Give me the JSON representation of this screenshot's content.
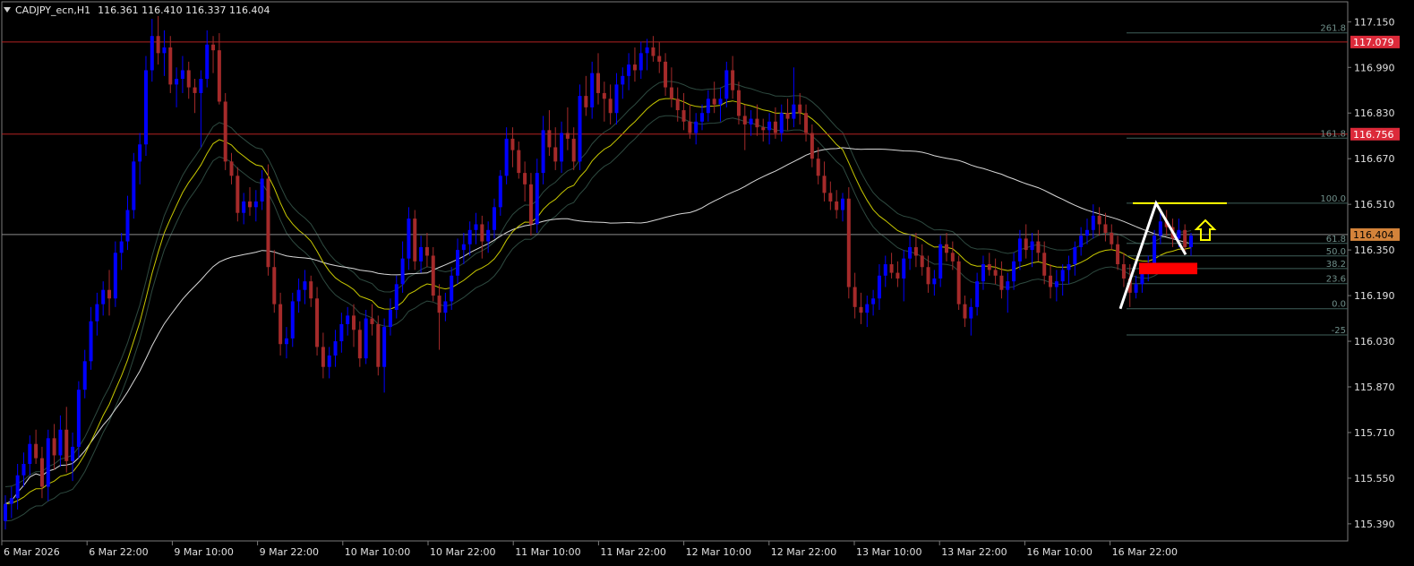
{
  "header": {
    "symbol": "CADJPY_ecn,H1",
    "ohlc": "116.361 116.410 116.337 116.404"
  },
  "colors": {
    "background": "#000000",
    "grid_frame": "#7a7a7a",
    "bull_candle": "#0000ff",
    "bear_candle": "#a52a2a",
    "ma_fast": "#c8c800",
    "ma_slow": "#d8d8d8",
    "envelope": "#2e4a40",
    "level_line": "#b22222",
    "fib_line": "#3f5f5a",
    "fib_label": "#6f8f8a",
    "price_tag": "#dc2a3a",
    "current_price_tag": "#d3833a",
    "accent_yellow": "#ffff00",
    "zone_red": "#ff0000"
  },
  "chart_data": {
    "type": "candlestick",
    "symbol": "CADJPY_ecn",
    "timeframe": "H1",
    "ylim": [
      115.33,
      117.22
    ],
    "y_ticks": [
      "117.150",
      "116.990",
      "116.830",
      "116.670",
      "116.510",
      "116.350",
      "116.190",
      "116.030",
      "115.870",
      "115.710",
      "115.550",
      "115.390"
    ],
    "x_ticks": [
      "6 Mar 2026",
      "6 Mar 22:00",
      "9 Mar 10:00",
      "9 Mar 22:00",
      "10 Mar 10:00",
      "10 Mar 22:00",
      "11 Mar 10:00",
      "11 Mar 22:00",
      "12 Mar 10:00",
      "12 Mar 22:00",
      "13 Mar 10:00",
      "13 Mar 22:00",
      "16 Mar 10:00",
      "16 Mar 22:00"
    ],
    "price_tags": [
      {
        "label": "117.079",
        "kind": "level"
      },
      {
        "label": "116.756",
        "kind": "level"
      },
      {
        "label": "116.404",
        "kind": "current"
      }
    ],
    "horizontal_levels": [
      117.079,
      116.756
    ],
    "current_price": 116.404,
    "fibonacci": [
      {
        "label": "261.8",
        "price": 117.111
      },
      {
        "label": "161.8",
        "price": 116.742
      },
      {
        "label": "100.0",
        "price": 116.514
      },
      {
        "label": "61.8",
        "price": 116.373
      },
      {
        "label": "50.0",
        "price": 116.329
      },
      {
        "label": "38.2",
        "price": 116.285
      },
      {
        "label": "23.6",
        "price": 116.232
      },
      {
        "label": "0.0",
        "price": 116.144
      },
      {
        "label": "-25",
        "price": 116.052
      }
    ],
    "ohlc": [
      [
        115.4,
        115.49,
        115.37,
        115.46
      ],
      [
        115.46,
        115.52,
        115.41,
        115.48
      ],
      [
        115.48,
        115.6,
        115.44,
        115.56
      ],
      [
        115.56,
        115.64,
        115.52,
        115.6
      ],
      [
        115.6,
        115.7,
        115.56,
        115.67
      ],
      [
        115.67,
        115.72,
        115.6,
        115.62
      ],
      [
        115.62,
        115.66,
        115.48,
        115.52
      ],
      [
        115.52,
        115.72,
        115.47,
        115.69
      ],
      [
        115.69,
        115.74,
        115.58,
        115.63
      ],
      [
        115.63,
        115.77,
        115.59,
        115.72
      ],
      [
        115.72,
        115.8,
        115.57,
        115.61
      ],
      [
        115.61,
        115.71,
        115.54,
        115.66
      ],
      [
        115.66,
        115.89,
        115.62,
        115.86
      ],
      [
        115.86,
        116.0,
        115.83,
        115.96
      ],
      [
        115.96,
        116.15,
        115.93,
        116.1
      ],
      [
        116.1,
        116.2,
        116.05,
        116.16
      ],
      [
        116.16,
        116.24,
        116.12,
        116.21
      ],
      [
        116.21,
        116.28,
        116.12,
        116.18
      ],
      [
        116.18,
        116.38,
        116.15,
        116.34
      ],
      [
        116.34,
        116.41,
        116.28,
        116.38
      ],
      [
        116.38,
        116.54,
        116.35,
        116.49
      ],
      [
        116.49,
        116.69,
        116.46,
        116.66
      ],
      [
        116.66,
        116.76,
        116.58,
        116.72
      ],
      [
        116.72,
        117.03,
        116.68,
        116.98
      ],
      [
        116.98,
        117.16,
        116.94,
        117.1
      ],
      [
        117.1,
        117.17,
        117.0,
        117.04
      ],
      [
        117.04,
        117.12,
        116.96,
        117.06
      ],
      [
        117.06,
        117.1,
        116.9,
        116.93
      ],
      [
        116.93,
        116.99,
        116.85,
        116.95
      ],
      [
        116.95,
        117.03,
        116.9,
        116.98
      ],
      [
        116.98,
        117.01,
        116.88,
        116.92
      ],
      [
        116.92,
        116.95,
        116.83,
        116.9
      ],
      [
        116.9,
        116.98,
        116.71,
        116.95
      ],
      [
        116.95,
        117.12,
        116.92,
        117.07
      ],
      [
        117.07,
        117.1,
        116.97,
        117.05
      ],
      [
        117.05,
        117.11,
        116.86,
        116.87
      ],
      [
        116.87,
        116.9,
        116.63,
        116.66
      ],
      [
        116.66,
        116.69,
        116.58,
        116.61
      ],
      [
        116.61,
        116.64,
        116.45,
        116.48
      ],
      [
        116.48,
        116.55,
        116.44,
        116.52
      ],
      [
        116.52,
        116.57,
        116.47,
        116.5
      ],
      [
        116.5,
        116.56,
        116.45,
        116.52
      ],
      [
        116.52,
        116.63,
        116.49,
        116.6
      ],
      [
        116.6,
        116.65,
        116.26,
        116.29
      ],
      [
        116.29,
        116.35,
        116.13,
        116.16
      ],
      [
        116.16,
        116.2,
        115.98,
        116.02
      ],
      [
        116.02,
        116.08,
        115.97,
        116.04
      ],
      [
        116.04,
        116.2,
        116.01,
        116.17
      ],
      [
        116.17,
        116.25,
        116.13,
        116.21
      ],
      [
        116.21,
        116.28,
        116.16,
        116.24
      ],
      [
        116.24,
        116.26,
        116.15,
        116.18
      ],
      [
        116.18,
        116.22,
        115.98,
        116.01
      ],
      [
        116.01,
        116.06,
        115.9,
        115.94
      ],
      [
        115.94,
        116.01,
        115.9,
        115.98
      ],
      [
        115.98,
        116.07,
        115.94,
        116.03
      ],
      [
        116.03,
        116.13,
        115.99,
        116.09
      ],
      [
        116.09,
        116.15,
        116.05,
        116.12
      ],
      [
        116.12,
        116.16,
        116.01,
        116.07
      ],
      [
        116.07,
        116.1,
        115.94,
        115.97
      ],
      [
        115.97,
        116.14,
        115.95,
        116.11
      ],
      [
        116.11,
        116.16,
        116.05,
        116.09
      ],
      [
        116.09,
        116.12,
        115.91,
        115.94
      ],
      [
        115.94,
        116.11,
        115.85,
        116.08
      ],
      [
        116.08,
        116.18,
        116.05,
        116.14
      ],
      [
        116.14,
        116.26,
        116.11,
        116.23
      ],
      [
        116.23,
        116.38,
        116.2,
        116.32
      ],
      [
        116.32,
        116.5,
        116.28,
        116.46
      ],
      [
        116.46,
        116.49,
        116.28,
        116.31
      ],
      [
        116.31,
        116.4,
        116.27,
        116.36
      ],
      [
        116.36,
        116.41,
        116.29,
        116.33
      ],
      [
        116.33,
        116.36,
        116.17,
        116.19
      ],
      [
        116.19,
        116.23,
        116.0,
        116.13
      ],
      [
        116.13,
        116.2,
        116.1,
        116.17
      ],
      [
        116.17,
        116.29,
        116.14,
        116.26
      ],
      [
        116.26,
        116.39,
        116.23,
        116.35
      ],
      [
        116.35,
        116.41,
        116.3,
        116.37
      ],
      [
        116.37,
        116.45,
        116.33,
        116.42
      ],
      [
        116.42,
        116.48,
        116.37,
        116.44
      ],
      [
        116.44,
        116.47,
        116.32,
        116.38
      ],
      [
        116.38,
        116.45,
        116.34,
        116.42
      ],
      [
        116.42,
        116.53,
        116.39,
        116.5
      ],
      [
        116.5,
        116.63,
        116.47,
        116.61
      ],
      [
        116.61,
        116.78,
        116.58,
        116.74
      ],
      [
        116.74,
        116.78,
        116.64,
        116.7
      ],
      [
        116.7,
        116.73,
        116.6,
        116.62
      ],
      [
        116.62,
        116.66,
        116.52,
        116.58
      ],
      [
        116.58,
        116.62,
        116.4,
        116.44
      ],
      [
        116.44,
        116.67,
        116.41,
        116.62
      ],
      [
        116.62,
        116.82,
        116.58,
        116.77
      ],
      [
        116.77,
        116.84,
        116.68,
        116.71
      ],
      [
        116.71,
        116.78,
        116.63,
        116.66
      ],
      [
        116.66,
        116.8,
        116.62,
        116.76
      ],
      [
        116.76,
        116.85,
        116.7,
        116.74
      ],
      [
        116.74,
        116.78,
        116.63,
        116.66
      ],
      [
        116.66,
        116.93,
        116.63,
        116.89
      ],
      [
        116.89,
        116.96,
        116.82,
        116.85
      ],
      [
        116.85,
        117.01,
        116.81,
        116.97
      ],
      [
        116.97,
        117.04,
        116.86,
        116.9
      ],
      [
        116.9,
        116.94,
        116.8,
        116.88
      ],
      [
        116.88,
        116.93,
        116.79,
        116.83
      ],
      [
        116.83,
        116.97,
        116.79,
        116.93
      ],
      [
        116.93,
        116.99,
        116.88,
        116.96
      ],
      [
        116.96,
        117.04,
        116.91,
        117.0
      ],
      [
        117.0,
        117.06,
        116.94,
        116.98
      ],
      [
        116.98,
        117.08,
        116.95,
        117.04
      ],
      [
        117.04,
        117.09,
        116.98,
        117.06
      ],
      [
        117.06,
        117.1,
        117.01,
        117.03
      ],
      [
        117.03,
        117.08,
        116.97,
        117.01
      ],
      [
        117.01,
        117.04,
        116.89,
        116.92
      ],
      [
        116.92,
        116.99,
        116.85,
        116.88
      ],
      [
        116.88,
        116.92,
        116.8,
        116.84
      ],
      [
        116.84,
        116.9,
        116.77,
        116.8
      ],
      [
        116.8,
        116.86,
        116.74,
        116.76
      ],
      [
        116.76,
        116.83,
        116.72,
        116.8
      ],
      [
        116.8,
        116.86,
        116.77,
        116.83
      ],
      [
        116.83,
        116.91,
        116.8,
        116.88
      ],
      [
        116.88,
        116.94,
        116.83,
        116.86
      ],
      [
        116.86,
        116.92,
        116.8,
        116.88
      ],
      [
        116.88,
        117.01,
        116.85,
        116.98
      ],
      [
        116.98,
        117.03,
        116.88,
        116.91
      ],
      [
        116.91,
        116.94,
        116.79,
        116.82
      ],
      [
        116.82,
        116.86,
        116.7,
        116.79
      ],
      [
        116.79,
        116.84,
        116.75,
        116.81
      ],
      [
        116.81,
        116.86,
        116.75,
        116.78
      ],
      [
        116.78,
        116.81,
        116.73,
        116.77
      ],
      [
        116.77,
        116.83,
        116.72,
        116.8
      ],
      [
        116.8,
        116.85,
        116.74,
        116.76
      ],
      [
        116.76,
        116.86,
        116.73,
        116.83
      ],
      [
        116.83,
        116.88,
        116.77,
        116.81
      ],
      [
        116.81,
        116.99,
        116.78,
        116.86
      ],
      [
        116.86,
        116.9,
        116.79,
        116.83
      ],
      [
        116.83,
        116.86,
        116.73,
        116.76
      ],
      [
        116.76,
        116.79,
        116.64,
        116.67
      ],
      [
        116.67,
        116.71,
        116.58,
        116.61
      ],
      [
        116.61,
        116.66,
        116.52,
        116.55
      ],
      [
        116.55,
        116.59,
        116.49,
        116.52
      ],
      [
        116.52,
        116.56,
        116.46,
        116.49
      ],
      [
        116.49,
        116.55,
        116.45,
        116.53
      ],
      [
        116.53,
        116.57,
        116.18,
        116.22
      ],
      [
        116.22,
        116.27,
        116.11,
        116.15
      ],
      [
        116.15,
        116.2,
        116.09,
        116.13
      ],
      [
        116.13,
        116.19,
        116.08,
        116.16
      ],
      [
        116.16,
        116.21,
        116.12,
        116.18
      ],
      [
        116.18,
        116.3,
        116.14,
        116.26
      ],
      [
        116.26,
        116.33,
        116.22,
        116.3
      ],
      [
        116.3,
        116.34,
        116.25,
        116.27
      ],
      [
        116.27,
        116.31,
        116.22,
        116.25
      ],
      [
        116.25,
        116.35,
        116.17,
        116.32
      ],
      [
        116.32,
        116.4,
        116.28,
        116.36
      ],
      [
        116.36,
        116.41,
        116.29,
        116.33
      ],
      [
        116.33,
        116.37,
        116.26,
        116.29
      ],
      [
        116.29,
        116.33,
        116.2,
        116.23
      ],
      [
        116.23,
        116.28,
        116.19,
        116.25
      ],
      [
        116.25,
        116.4,
        116.22,
        116.37
      ],
      [
        116.37,
        116.41,
        116.31,
        116.34
      ],
      [
        116.34,
        116.38,
        116.28,
        116.31
      ],
      [
        116.31,
        116.33,
        116.14,
        116.16
      ],
      [
        116.16,
        116.19,
        116.08,
        116.11
      ],
      [
        116.11,
        116.18,
        116.05,
        116.15
      ],
      [
        116.15,
        116.27,
        116.12,
        116.24
      ],
      [
        116.24,
        116.33,
        116.21,
        116.3
      ],
      [
        116.3,
        116.34,
        116.26,
        116.28
      ],
      [
        116.28,
        116.32,
        116.23,
        116.26
      ],
      [
        116.26,
        116.31,
        116.18,
        116.21
      ],
      [
        116.21,
        116.27,
        116.13,
        116.24
      ],
      [
        116.24,
        116.34,
        116.21,
        116.31
      ],
      [
        116.31,
        116.42,
        116.28,
        116.39
      ],
      [
        116.39,
        116.44,
        116.32,
        116.35
      ],
      [
        116.35,
        116.41,
        116.29,
        116.38
      ],
      [
        116.38,
        116.42,
        116.31,
        116.34
      ],
      [
        116.34,
        116.38,
        116.23,
        116.26
      ],
      [
        116.26,
        116.3,
        116.18,
        116.22
      ],
      [
        116.22,
        116.28,
        116.17,
        116.24
      ],
      [
        116.24,
        116.3,
        116.19,
        116.28
      ],
      [
        116.28,
        116.33,
        116.23,
        116.3
      ],
      [
        116.3,
        116.38,
        116.26,
        116.36
      ],
      [
        116.36,
        116.43,
        116.33,
        116.4
      ],
      [
        116.4,
        116.46,
        116.37,
        116.42
      ],
      [
        116.42,
        116.51,
        116.39,
        116.47
      ],
      [
        116.47,
        116.5,
        116.4,
        116.44
      ],
      [
        116.44,
        116.48,
        116.38,
        116.41
      ],
      [
        116.41,
        116.44,
        116.35,
        116.37
      ],
      [
        116.37,
        116.4,
        116.28,
        116.3
      ],
      [
        116.3,
        116.34,
        116.22,
        116.25
      ],
      [
        116.25,
        116.3,
        116.15,
        116.2
      ],
      [
        116.2,
        116.26,
        116.18,
        116.23
      ],
      [
        116.23,
        116.3,
        116.2,
        116.28
      ],
      [
        116.28,
        116.33,
        116.24,
        116.3
      ],
      [
        116.3,
        116.42,
        116.28,
        116.4
      ],
      [
        116.4,
        116.48,
        116.37,
        116.45
      ],
      [
        116.45,
        116.49,
        116.4,
        116.43
      ],
      [
        116.43,
        116.46,
        116.36,
        116.39
      ],
      [
        116.39,
        116.46,
        116.36,
        116.42
      ],
      [
        116.42,
        116.44,
        116.34,
        116.36
      ],
      [
        116.36,
        116.41,
        116.33,
        116.4
      ]
    ]
  }
}
